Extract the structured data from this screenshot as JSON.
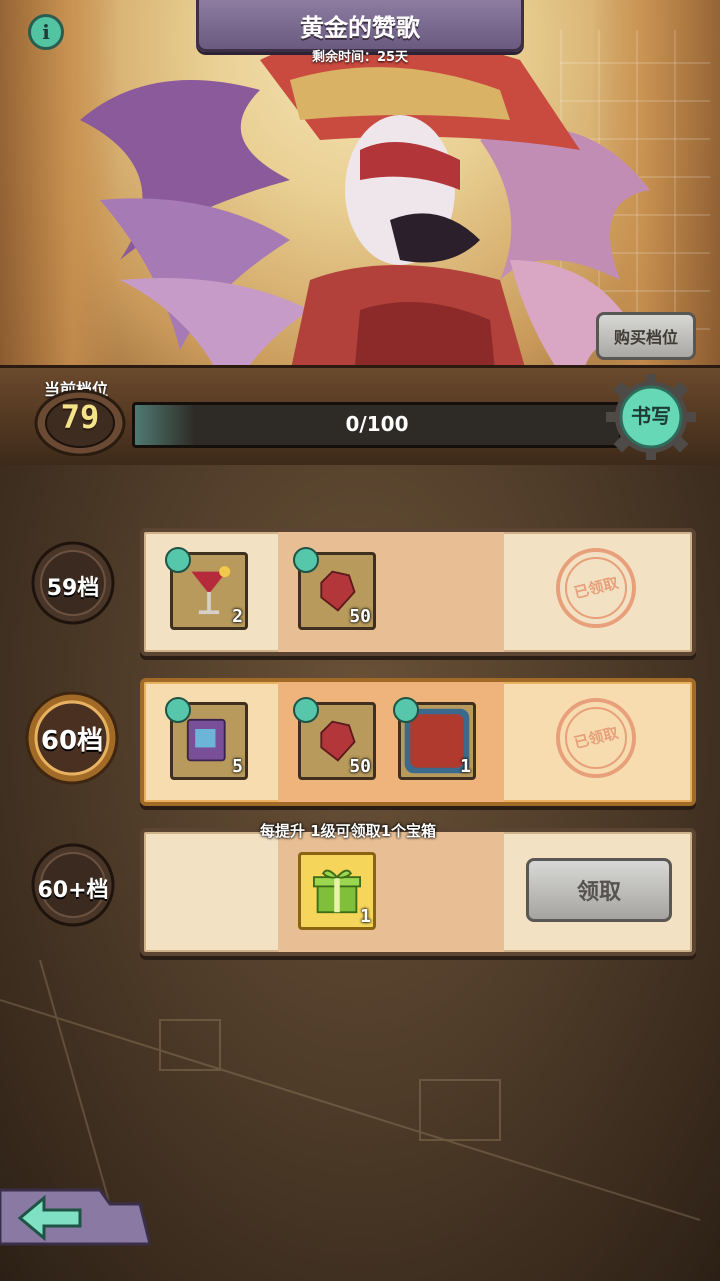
{
  "header": {
    "title": "黄金的赞歌",
    "remaining_time": "剩余时间：25天",
    "info_icon": "info-icon"
  },
  "buy_tier_button": "购买档位",
  "progress": {
    "label": "当前档位",
    "current_level": "79",
    "value_text": "0/100",
    "fraction": 0.0,
    "write_button": "书写"
  },
  "tiers": [
    {
      "label": "59档",
      "items": [
        {
          "icon": "cocktail-glass-icon",
          "count": "2",
          "claimed": true
        },
        {
          "icon": "red-gem-icon",
          "count": "50",
          "claimed": true
        }
      ],
      "status": "已领取"
    },
    {
      "label": "60档",
      "items": [
        {
          "icon": "purple-book-icon",
          "count": "5",
          "claimed": true
        },
        {
          "icon": "red-gem-icon",
          "count": "50",
          "claimed": true
        },
        {
          "icon": "red-frame-icon",
          "count": "1",
          "claimed": true
        }
      ],
      "status": "已领取"
    },
    {
      "label": "60+档",
      "hint": "每提升 1级可领取1个宝箱",
      "items": [
        {
          "icon": "green-gift-box-icon",
          "count": "1",
          "claimed": false
        }
      ],
      "claim_button": "领取"
    }
  ],
  "colors": {
    "accent_teal": "#53c3a2",
    "level_yellow": "#f5e38a",
    "stamp_orange": "#e7a07a"
  },
  "back_icon": "back-arrow-icon"
}
